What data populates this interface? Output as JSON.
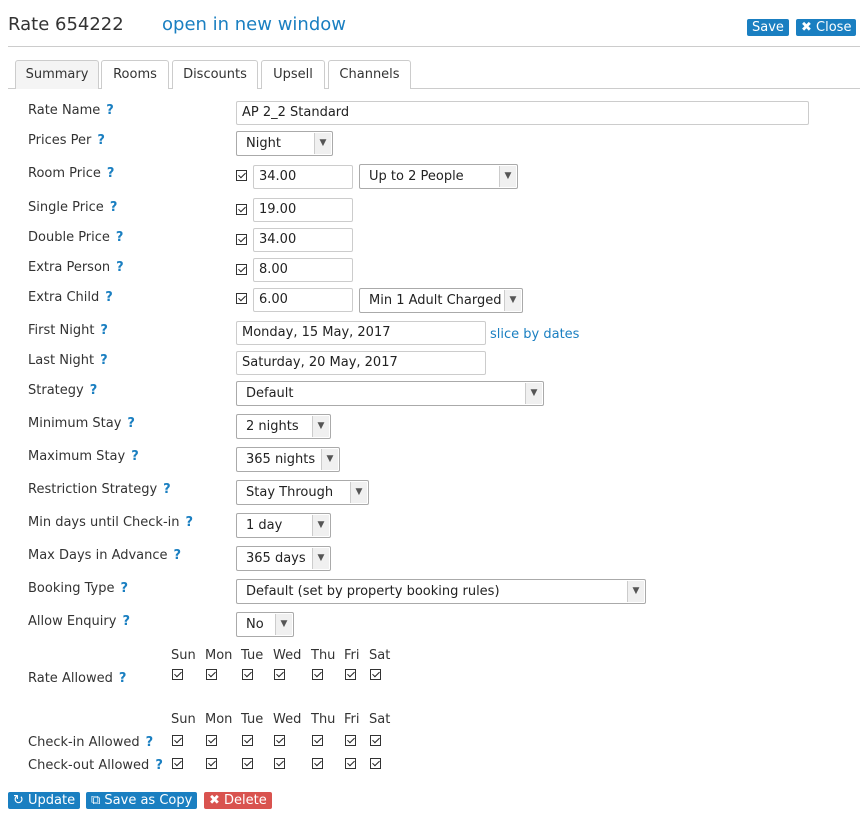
{
  "header": {
    "title": "Rate 654222",
    "open_link": "open in new window",
    "save_label": "Save",
    "close_label": "✖ Close"
  },
  "tabs": [
    "Summary",
    "Rooms",
    "Discounts",
    "Upsell",
    "Channels"
  ],
  "form": {
    "rate_name": {
      "label": "Rate Name",
      "help": "?",
      "value": "AP 2_2 Standard"
    },
    "prices_per": {
      "label": "Prices Per",
      "help": "?",
      "value": "Night"
    },
    "room_price": {
      "label": "Room Price",
      "help": "?",
      "value": "34.00",
      "people": "Up to 2 People"
    },
    "single_price": {
      "label": "Single Price",
      "help": "?",
      "value": "19.00"
    },
    "double_price": {
      "label": "Double Price",
      "help": "?",
      "value": "34.00"
    },
    "extra_person": {
      "label": "Extra Person",
      "help": "?",
      "value": "8.00"
    },
    "extra_child": {
      "label": "Extra Child",
      "help": "?",
      "value": "6.00",
      "rule": "Min 1 Adult Charged"
    },
    "first_night": {
      "label": "First Night",
      "help": "?",
      "value": "Monday, 15 May, 2017",
      "link": "slice by dates"
    },
    "last_night": {
      "label": "Last Night",
      "help": "?",
      "value": "Saturday, 20 May, 2017"
    },
    "strategy": {
      "label": "Strategy",
      "help": "?",
      "value": "Default"
    },
    "minimum_stay": {
      "label": "Minimum Stay",
      "help": "?",
      "value": "2 nights"
    },
    "maximum_stay": {
      "label": "Maximum Stay",
      "help": "?",
      "value": "365 nights"
    },
    "restriction_strategy": {
      "label": "Restriction Strategy",
      "help": "?",
      "value": "Stay Through"
    },
    "min_days": {
      "label": "Min days until Check-in",
      "help": "?",
      "value": "1 day"
    },
    "max_days": {
      "label": "Max Days in Advance",
      "help": "?",
      "value": "365 days"
    },
    "booking_type": {
      "label": "Booking Type",
      "help": "?",
      "value": "Default (set by property booking rules)"
    },
    "allow_enquiry": {
      "label": "Allow Enquiry",
      "help": "?",
      "value": "No"
    }
  },
  "days": [
    "Sun",
    "Mon",
    "Tue",
    "Wed",
    "Thu",
    "Fri",
    "Sat"
  ],
  "day_grids": {
    "rate_allowed": {
      "label": "Rate Allowed",
      "help": "?",
      "checked": [
        true,
        true,
        true,
        true,
        true,
        true,
        true
      ]
    },
    "checkin_allowed": {
      "label": "Check-in Allowed",
      "help": "?",
      "checked": [
        true,
        true,
        true,
        true,
        true,
        true,
        true
      ]
    },
    "checkout_allowed": {
      "label": "Check-out Allowed",
      "help": "?",
      "checked": [
        true,
        true,
        true,
        true,
        true,
        true,
        true
      ]
    }
  },
  "footer": {
    "update": "Update",
    "save_copy": "Save as Copy",
    "delete": "Delete"
  },
  "colors": {
    "accent": "#1a7fc1",
    "danger": "#d9534f"
  }
}
